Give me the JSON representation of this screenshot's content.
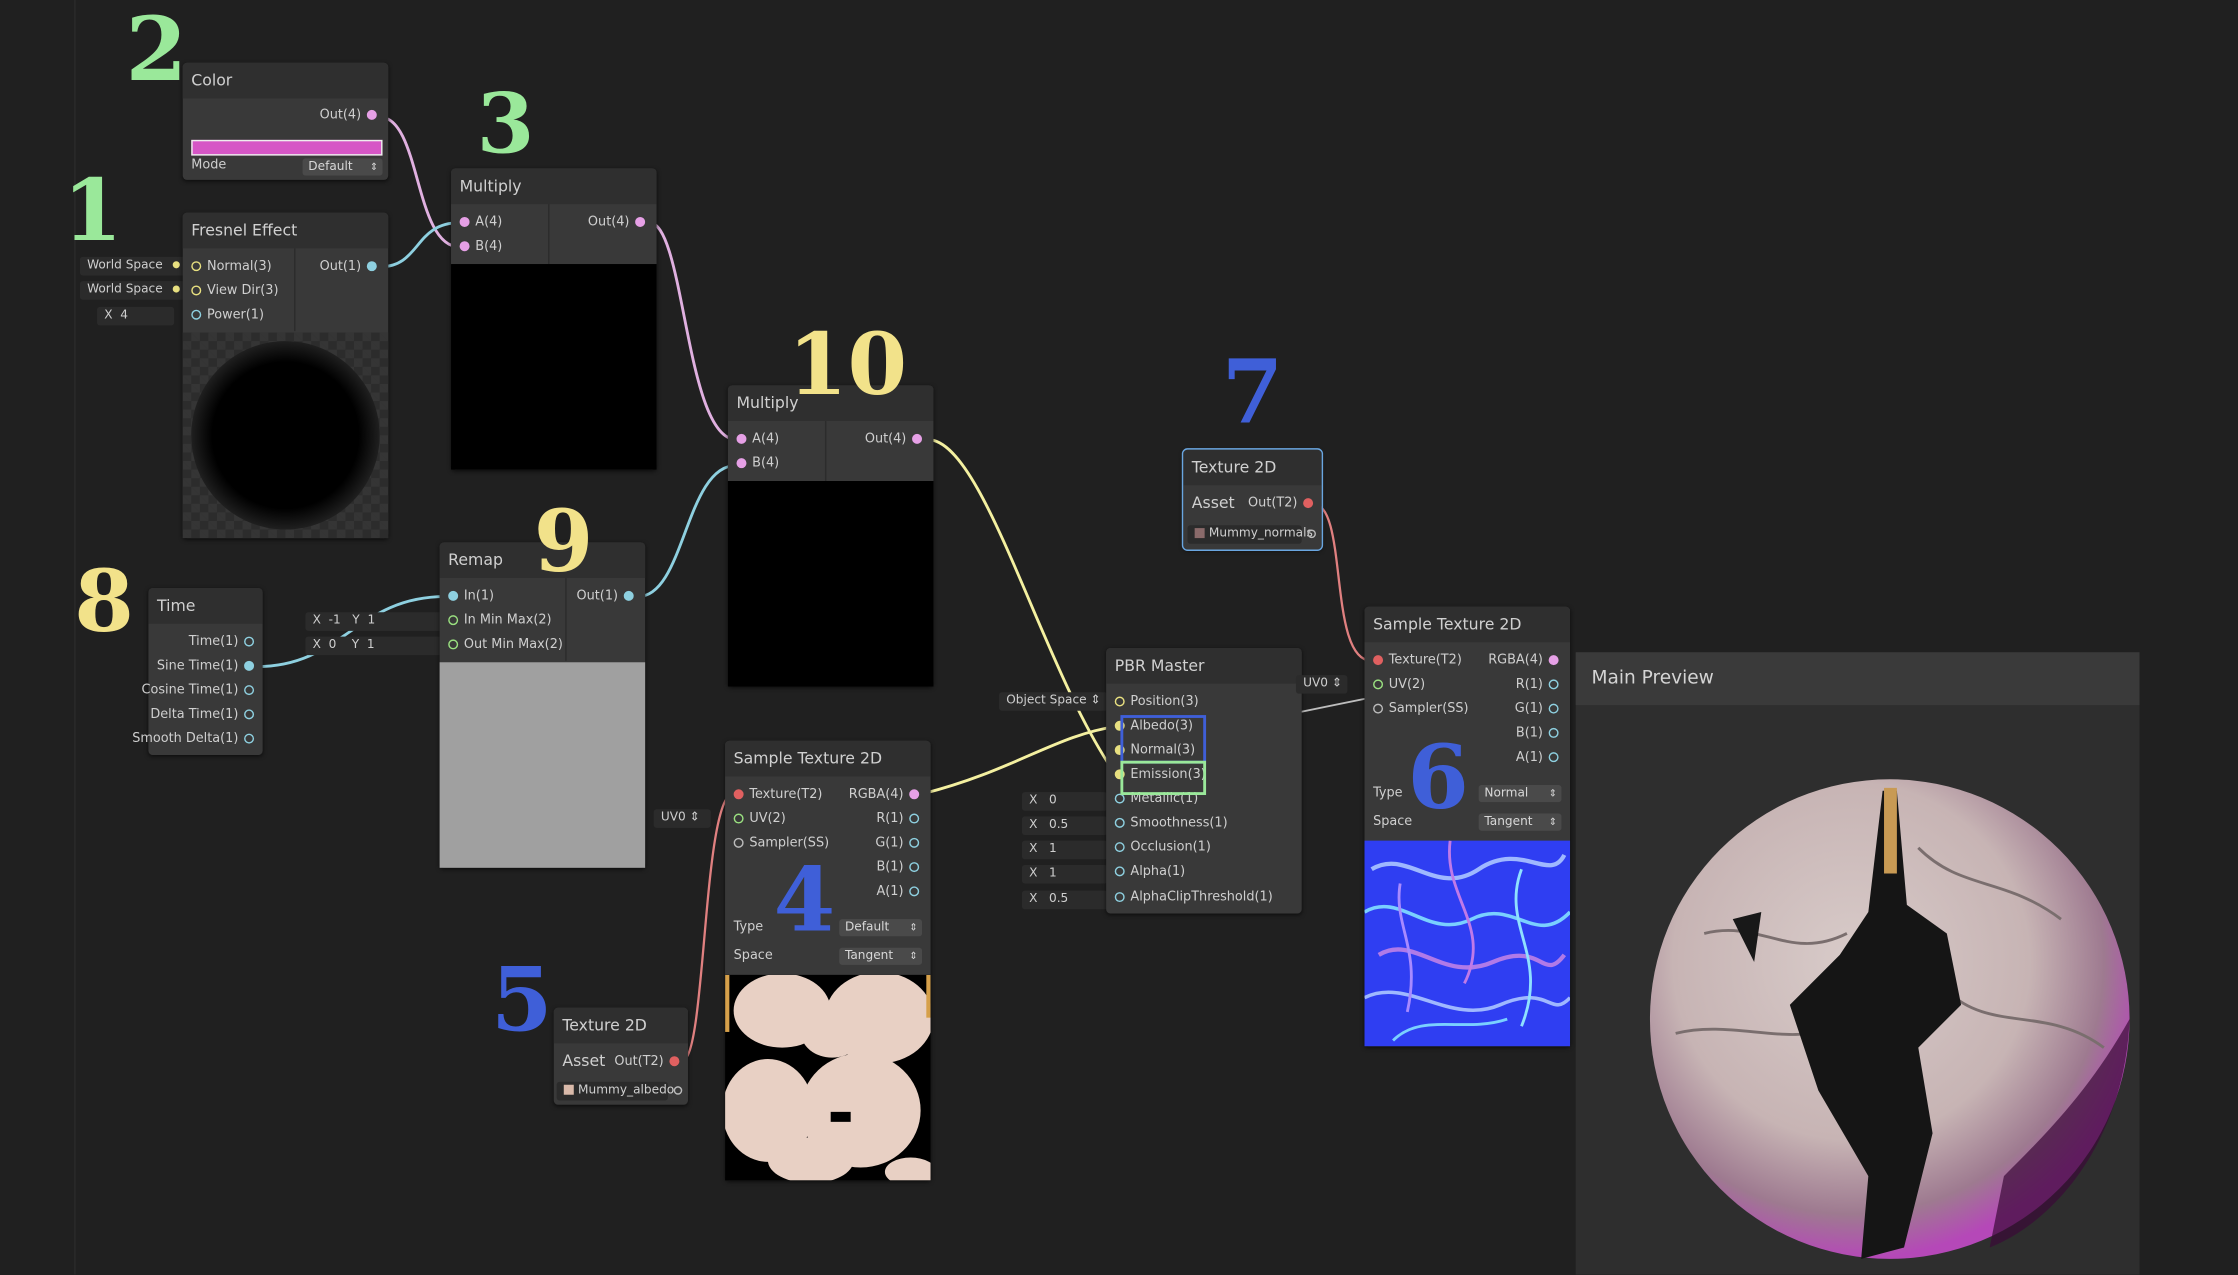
{
  "nodes": {
    "color": {
      "title": "Color",
      "out": "Out(4)",
      "mode_label": "Mode",
      "mode_value": "Default",
      "swatch": "#d656c6"
    },
    "fresnel": {
      "title": "Fresnel Effect",
      "in1": "Normal(3)",
      "in2": "View Dir(3)",
      "in3": "Power(1)",
      "out": "Out(1)",
      "chip1": "World Space",
      "chip2": "World Space",
      "chip3_x": "X",
      "chip3_val": "4"
    },
    "multiply_a": {
      "title": "Multiply",
      "in1": "A(4)",
      "in2": "B(4)",
      "out": "Out(4)"
    },
    "multiply_b": {
      "title": "Multiply",
      "in1": "A(4)",
      "in2": "B(4)",
      "out": "Out(4)"
    },
    "time": {
      "title": "Time",
      "p1": "Time(1)",
      "p2": "Sine Time(1)",
      "p3": "Cosine Time(1)",
      "p4": "Delta Time(1)",
      "p5": "Smooth Delta(1)"
    },
    "remap": {
      "title": "Remap",
      "in1": "In(1)",
      "in2": "In Min Max(2)",
      "in3": "Out Min Max(2)",
      "out": "Out(1)",
      "c1x": "X",
      "c1xv": "-1",
      "c1y": "Y",
      "c1yv": "1",
      "c2x": "X",
      "c2xv": "0",
      "c2y": "Y",
      "c2yv": "1"
    },
    "tex_normals": {
      "title": "Texture 2D Asset",
      "out": "Out(T2)",
      "asset": "Mummy_normals"
    },
    "tex_albedo": {
      "title": "Texture 2D Asset",
      "out": "Out(T2)",
      "asset": "Mummy_albedo"
    },
    "sample_albedo": {
      "title": "Sample Texture 2D",
      "in1": "Texture(T2)",
      "in2": "UV(2)",
      "in3": "Sampler(SS)",
      "o1": "RGBA(4)",
      "o2": "R(1)",
      "o3": "G(1)",
      "o4": "B(1)",
      "o5": "A(1)",
      "type_label": "Type",
      "type_value": "Default",
      "space_label": "Space",
      "space_value": "Tangent",
      "uv_chip": "UV0"
    },
    "sample_normal": {
      "title": "Sample Texture 2D",
      "in1": "Texture(T2)",
      "in2": "UV(2)",
      "in3": "Sampler(SS)",
      "o1": "RGBA(4)",
      "o2": "R(1)",
      "o3": "G(1)",
      "o4": "B(1)",
      "o5": "A(1)",
      "type_label": "Type",
      "type_value": "Normal",
      "space_label": "Space",
      "space_value": "Tangent",
      "uv_chip": "UV0"
    },
    "pbr": {
      "title": "PBR Master",
      "p1": "Position(3)",
      "p2": "Albedo(3)",
      "p3": "Normal(3)",
      "p4": "Emission(3)",
      "p5": "Metallic(1)",
      "p6": "Smoothness(1)",
      "p7": "Occlusion(1)",
      "p8": "Alpha(1)",
      "p9": "AlphaClipThreshold(1)",
      "space_chip": "Object Space",
      "x": "X",
      "v_metallic": "0",
      "v_smooth": "0.5",
      "v_occ": "1",
      "v_alpha": "1",
      "v_clip": "0.5"
    }
  },
  "preview": {
    "title": "Main Preview"
  },
  "annotations": [
    "1",
    "2",
    "3",
    "4",
    "5",
    "6",
    "7",
    "8",
    "9",
    "10"
  ],
  "colors": {
    "background": "#202020",
    "node": "#393939",
    "wire_vector4": "#e0b0e0",
    "wire_vector1": "#8ed0e0",
    "wire_vector3": "#f4f0a0",
    "wire_texture": "#e08080",
    "green_note": "#9ae89a",
    "blue_note": "#3f5fd8",
    "yellow_note": "#f2e28a"
  }
}
